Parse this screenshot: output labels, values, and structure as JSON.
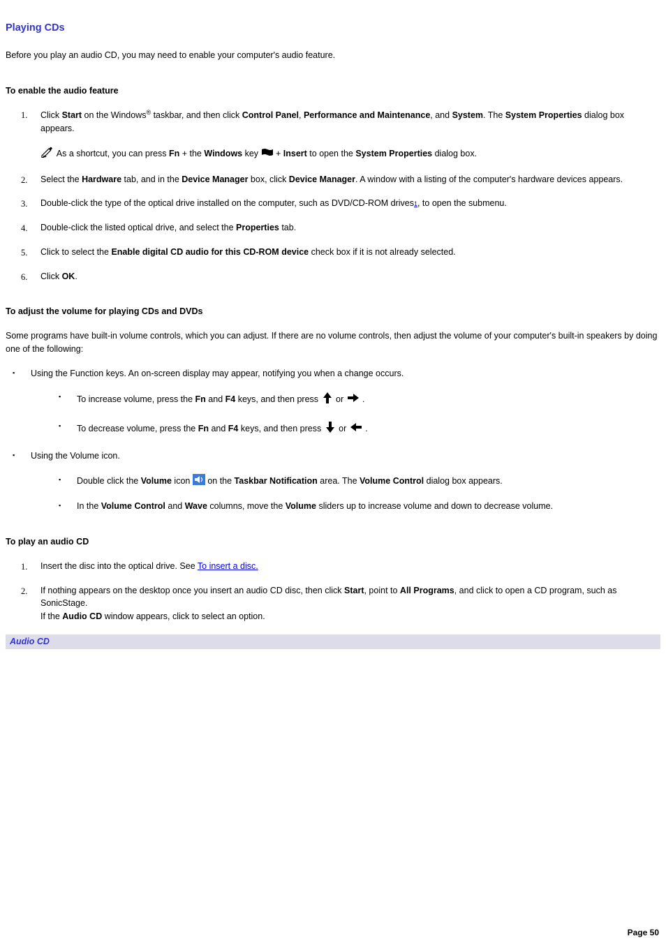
{
  "title": "Playing CDs",
  "intro": "Before you play an audio CD, you may need to enable your computer's audio feature.",
  "section_enable": {
    "heading": "To enable the audio feature",
    "steps": [
      {
        "num": "1",
        "parts": [
          {
            "t": "text",
            "v": "Click "
          },
          {
            "t": "bold",
            "v": "Start"
          },
          {
            "t": "text",
            "v": " on the Windows"
          },
          {
            "t": "sup",
            "v": "®"
          },
          {
            "t": "text",
            "v": " taskbar, and then click "
          },
          {
            "t": "bold",
            "v": "Control Panel"
          },
          {
            "t": "text",
            "v": ", "
          },
          {
            "t": "bold",
            "v": "Performance and Maintenance"
          },
          {
            "t": "text",
            "v": ", and "
          },
          {
            "t": "bold",
            "v": "System"
          },
          {
            "t": "text",
            "v": ". The "
          },
          {
            "t": "bold",
            "v": "System Properties"
          },
          {
            "t": "text",
            "v": " dialog box appears."
          }
        ],
        "note": [
          {
            "t": "icon",
            "v": "note-icon"
          },
          {
            "t": "text",
            "v": " As a shortcut, you can press "
          },
          {
            "t": "bold",
            "v": "Fn"
          },
          {
            "t": "text",
            "v": " + the "
          },
          {
            "t": "bold",
            "v": "Windows"
          },
          {
            "t": "text",
            "v": " key "
          },
          {
            "t": "icon",
            "v": "windows-key-icon"
          },
          {
            "t": "text",
            "v": " + "
          },
          {
            "t": "bold",
            "v": "Insert"
          },
          {
            "t": "text",
            "v": " to open the "
          },
          {
            "t": "bold",
            "v": "System Properties"
          },
          {
            "t": "text",
            "v": " dialog box."
          }
        ]
      },
      {
        "num": "2",
        "parts": [
          {
            "t": "text",
            "v": "Select the "
          },
          {
            "t": "bold",
            "v": "Hardware"
          },
          {
            "t": "text",
            "v": " tab, and in the "
          },
          {
            "t": "bold",
            "v": "Device Manager"
          },
          {
            "t": "text",
            "v": " box, click "
          },
          {
            "t": "bold",
            "v": "Device Manager"
          },
          {
            "t": "text",
            "v": ". A window with a listing of the computer's hardware devices appears."
          }
        ]
      },
      {
        "num": "3",
        "parts": [
          {
            "t": "text",
            "v": "Double-click the type of the optical drive installed on the computer, such as DVD/CD-ROM drives"
          },
          {
            "t": "fnref",
            "v": "1"
          },
          {
            "t": "text",
            "v": ", to open the submenu."
          }
        ]
      },
      {
        "num": "4",
        "parts": [
          {
            "t": "text",
            "v": "Double-click the listed optical drive, and select the "
          },
          {
            "t": "bold",
            "v": "Properties"
          },
          {
            "t": "text",
            "v": " tab."
          }
        ]
      },
      {
        "num": "5",
        "parts": [
          {
            "t": "text",
            "v": "Click to select the "
          },
          {
            "t": "bold",
            "v": "Enable digital CD audio for this CD-ROM device"
          },
          {
            "t": "text",
            "v": " check box if it is not already selected."
          }
        ]
      },
      {
        "num": "6",
        "parts": [
          {
            "t": "text",
            "v": "Click "
          },
          {
            "t": "bold",
            "v": "OK"
          },
          {
            "t": "text",
            "v": "."
          }
        ]
      }
    ]
  },
  "section_volume": {
    "heading": "To adjust the volume for playing CDs and DVDs",
    "intro": "Some programs have built-in volume controls, which you can adjust. If there are no volume controls, then adjust the volume of your computer's built-in speakers by doing one of the following:",
    "bullets": [
      {
        "text": "Using the Function keys. An on-screen display may appear, notifying you when a change occurs.",
        "subbullets": [
          {
            "parts": [
              {
                "t": "text",
                "v": "To increase volume, press the "
              },
              {
                "t": "bold",
                "v": "Fn"
              },
              {
                "t": "text",
                "v": " and "
              },
              {
                "t": "bold",
                "v": "F4"
              },
              {
                "t": "text",
                "v": " keys, and then press  "
              },
              {
                "t": "icon",
                "v": "arrow-up-icon"
              },
              {
                "t": "text",
                "v": " or "
              },
              {
                "t": "icon",
                "v": "arrow-right-icon"
              },
              {
                "t": "text",
                "v": " ."
              }
            ]
          },
          {
            "parts": [
              {
                "t": "text",
                "v": "To decrease volume, press the "
              },
              {
                "t": "bold",
                "v": "Fn"
              },
              {
                "t": "text",
                "v": " and "
              },
              {
                "t": "bold",
                "v": "F4"
              },
              {
                "t": "text",
                "v": " keys, and then press  "
              },
              {
                "t": "icon",
                "v": "arrow-down-icon"
              },
              {
                "t": "text",
                "v": " or "
              },
              {
                "t": "icon",
                "v": "arrow-left-icon"
              },
              {
                "t": "text",
                "v": " ."
              }
            ]
          }
        ]
      },
      {
        "text": "Using the Volume icon.",
        "subbullets": [
          {
            "parts": [
              {
                "t": "text",
                "v": "Double click the "
              },
              {
                "t": "bold",
                "v": "Volume"
              },
              {
                "t": "text",
                "v": " icon "
              },
              {
                "t": "icon",
                "v": "volume-tray-icon"
              },
              {
                "t": "text",
                "v": " on the "
              },
              {
                "t": "bold",
                "v": "Taskbar Notification"
              },
              {
                "t": "text",
                "v": " area. The "
              },
              {
                "t": "bold",
                "v": "Volume Control"
              },
              {
                "t": "text",
                "v": " dialog box appears."
              }
            ]
          },
          {
            "parts": [
              {
                "t": "text",
                "v": "In the "
              },
              {
                "t": "bold",
                "v": "Volume Control"
              },
              {
                "t": "text",
                "v": " and "
              },
              {
                "t": "bold",
                "v": "Wave"
              },
              {
                "t": "text",
                "v": " columns, move the "
              },
              {
                "t": "bold",
                "v": "Volume"
              },
              {
                "t": "text",
                "v": " sliders up to increase volume and down to decrease volume."
              }
            ]
          }
        ]
      }
    ]
  },
  "section_play": {
    "heading": "To play an audio CD",
    "steps": [
      {
        "num": "1",
        "parts": [
          {
            "t": "text",
            "v": "Insert the disc into the optical drive. See "
          },
          {
            "t": "link",
            "v": "To insert a disc."
          }
        ]
      },
      {
        "num": "2",
        "parts": [
          {
            "t": "text",
            "v": "If nothing appears on the desktop once you insert an audio CD disc, then click "
          },
          {
            "t": "bold",
            "v": "Start"
          },
          {
            "t": "text",
            "v": ", point to "
          },
          {
            "t": "bold",
            "v": "All Programs"
          },
          {
            "t": "text",
            "v": ", and click to open a CD program, such as SonicStage."
          },
          {
            "t": "br"
          },
          {
            "t": "text",
            "v": "If the "
          },
          {
            "t": "bold",
            "v": "Audio CD"
          },
          {
            "t": "text",
            "v": " window appears, click to select an option."
          }
        ]
      }
    ]
  },
  "caption": "Audio CD",
  "page_footer": "Page 50",
  "icons": {
    "note-icon": "pencil-note",
    "windows-key-icon": "windows-flag",
    "arrow-up-icon": "arrow-up",
    "arrow-right-icon": "arrow-right",
    "arrow-down-icon": "arrow-down",
    "arrow-left-icon": "arrow-left",
    "volume-tray-icon": "volume-tray"
  }
}
